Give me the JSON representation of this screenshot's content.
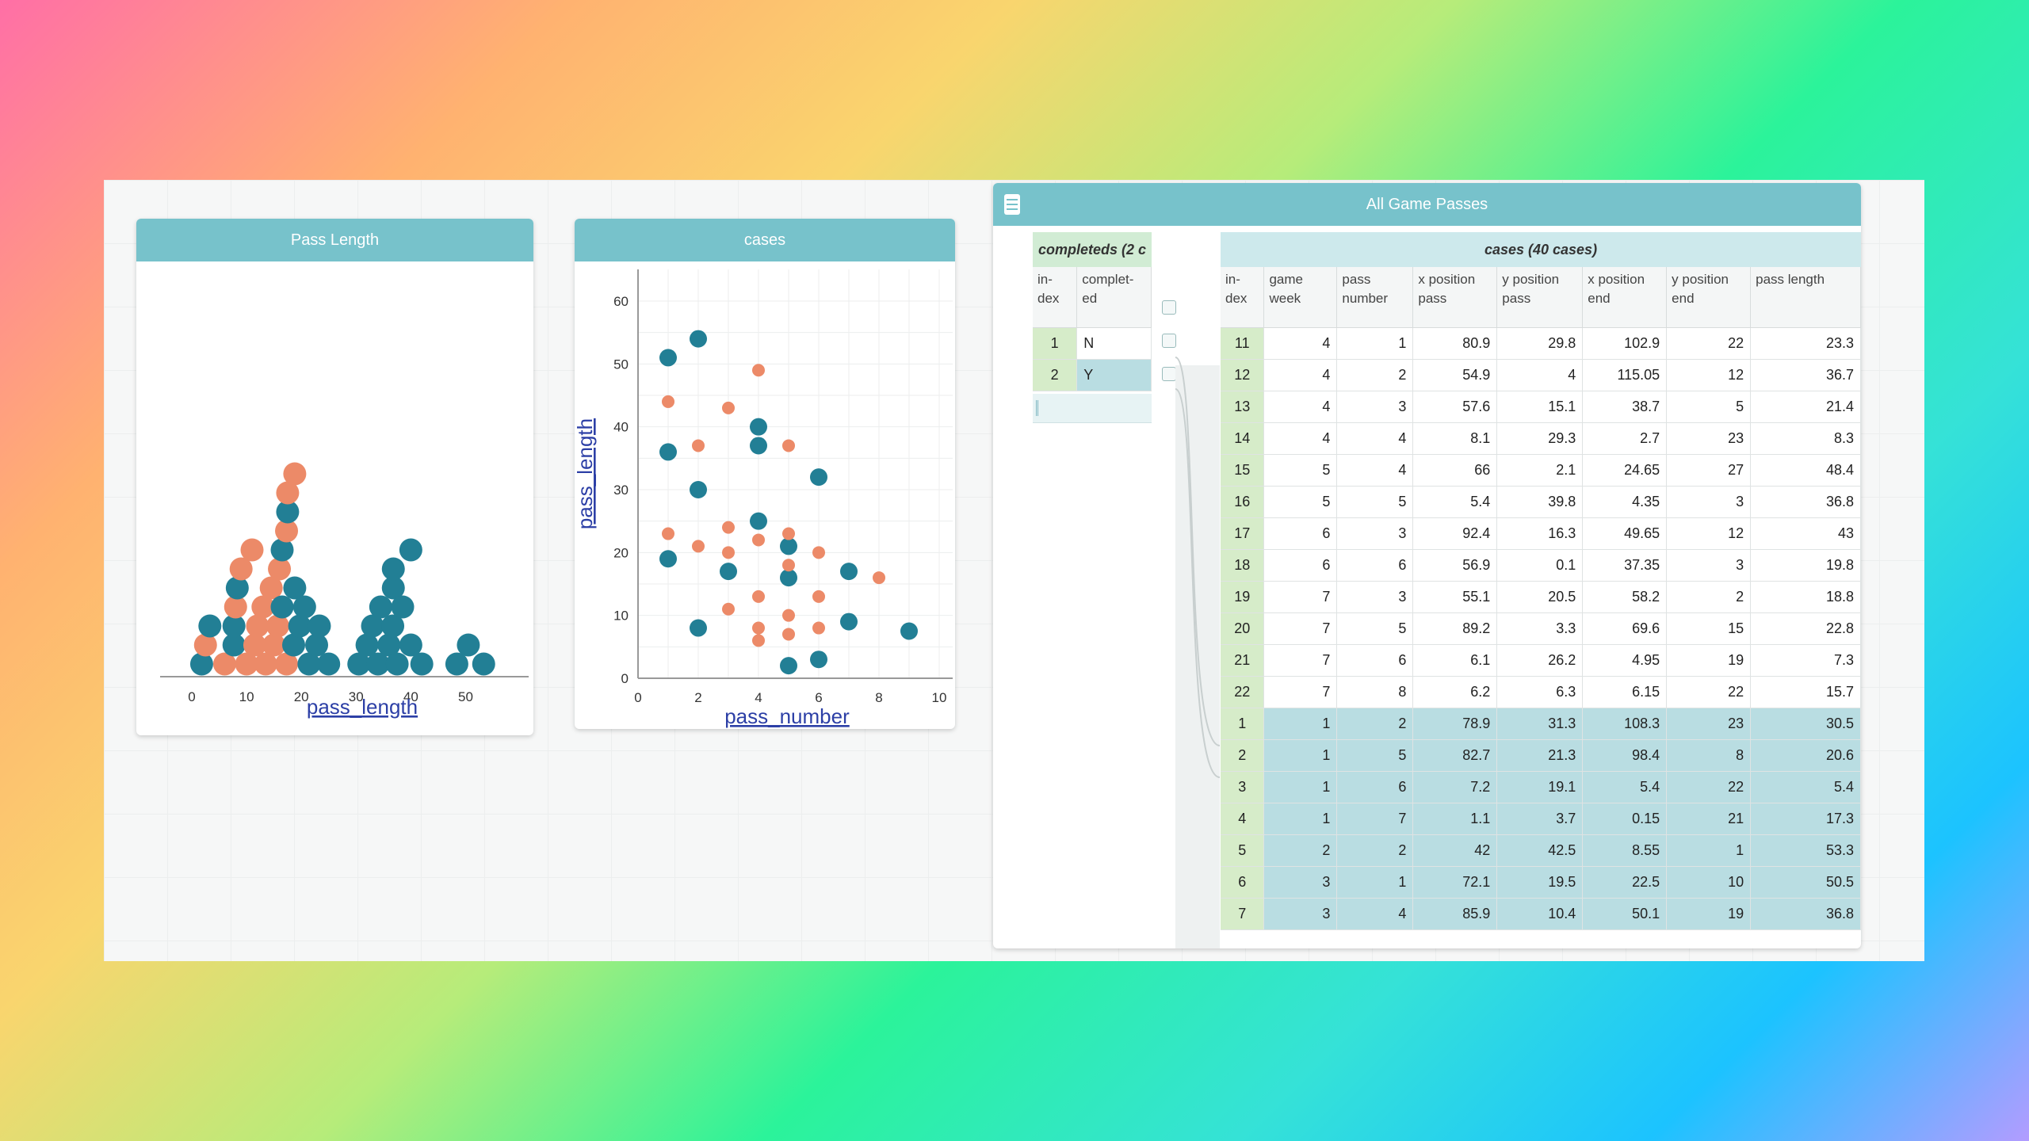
{
  "graph1": {
    "title": "Pass Length",
    "x_label": "pass_length",
    "x_ticks": [
      "0",
      "10",
      "20",
      "30",
      "40",
      "50"
    ]
  },
  "graph2": {
    "title": "cases",
    "x_label": "pass_number",
    "y_label": "pass_length",
    "x_ticks": [
      "0",
      "2",
      "4",
      "6",
      "8",
      "10"
    ],
    "y_ticks": [
      "0",
      "10",
      "20",
      "30",
      "40",
      "50",
      "60"
    ]
  },
  "colors": {
    "teal": "#227f95",
    "orange": "#ec8a68",
    "header": "#77c2cb"
  },
  "chart_data": [
    {
      "type": "dot plot",
      "title": "Pass Length",
      "xlabel": "pass_length",
      "xlim": [
        0,
        55
      ],
      "series": [
        {
          "values": [
            1.8,
            3.3,
            7.7,
            7.7,
            8.3,
            16.5,
            16.5,
            17.5,
            18.6,
            18.8,
            19.7,
            20.6,
            21.4,
            22.8,
            23.3,
            25.0,
            30.5,
            32.0,
            33.0,
            34.0,
            34.5,
            36.0,
            36.7,
            36.8,
            36.8,
            37.5,
            38.5,
            40.0,
            40.0,
            42.0,
            48.4,
            50.5,
            53.3
          ]
        },
        {
          "values": [
            2.5,
            6.0,
            8.0,
            9.0,
            10.0,
            11.0,
            11.5,
            12.0,
            13.0,
            13.5,
            14.5,
            15.0,
            15.7,
            16.0,
            17.3,
            17.3,
            17.5,
            18.8
          ]
        }
      ]
    },
    {
      "type": "scatter",
      "title": "cases",
      "xlabel": "pass_number",
      "ylabel": "pass_length",
      "xlim": [
        0,
        10
      ],
      "ylim": [
        0,
        60
      ],
      "series": [
        {
          "points": [
            [
              1,
              51
            ],
            [
              1,
              36
            ],
            [
              1,
              19
            ],
            [
              2,
              54
            ],
            [
              2,
              30
            ],
            [
              2,
              8
            ],
            [
              3,
              17
            ],
            [
              4,
              40
            ],
            [
              4,
              37
            ],
            [
              4,
              25
            ],
            [
              5,
              21
            ],
            [
              5,
              16
            ],
            [
              5,
              2
            ],
            [
              6,
              32
            ],
            [
              6,
              3
            ],
            [
              7,
              17
            ],
            [
              7,
              9
            ],
            [
              9,
              7.5
            ]
          ]
        },
        {
          "points": [
            [
              1,
              44
            ],
            [
              1,
              23
            ],
            [
              2,
              37
            ],
            [
              2,
              21
            ],
            [
              3,
              43
            ],
            [
              3,
              24
            ],
            [
              3,
              20
            ],
            [
              3,
              11
            ],
            [
              4,
              49
            ],
            [
              4,
              22
            ],
            [
              4,
              13
            ],
            [
              4,
              8
            ],
            [
              4,
              6
            ],
            [
              5,
              37
            ],
            [
              5,
              23
            ],
            [
              5,
              18
            ],
            [
              5,
              10
            ],
            [
              5,
              7
            ],
            [
              6,
              20
            ],
            [
              6,
              13
            ],
            [
              6,
              8
            ],
            [
              8,
              16
            ]
          ]
        }
      ]
    }
  ],
  "table": {
    "title": "All Game Passes",
    "parent_label": "completeds (2 c",
    "child_label": "cases (40 cases)",
    "parent_cols": [
      "in-dex",
      "complet-ed"
    ],
    "parent_rows": [
      [
        "1",
        "N"
      ],
      [
        "2",
        "Y"
      ]
    ],
    "child_cols": [
      "in-dex",
      "game week",
      "pass number",
      "x position pass",
      "y position pass",
      "x position end",
      "y position end",
      "pass length"
    ],
    "child_rows": [
      [
        "11",
        "4",
        "1",
        "80.9",
        "29.8",
        "102.9",
        "22",
        "23.3"
      ],
      [
        "12",
        "4",
        "2",
        "54.9",
        "4",
        "115.05",
        "12",
        "36.7"
      ],
      [
        "13",
        "4",
        "3",
        "57.6",
        "15.1",
        "38.7",
        "5",
        "21.4"
      ],
      [
        "14",
        "4",
        "4",
        "8.1",
        "29.3",
        "2.7",
        "23",
        "8.3"
      ],
      [
        "15",
        "5",
        "4",
        "66",
        "2.1",
        "24.65",
        "27",
        "48.4"
      ],
      [
        "16",
        "5",
        "5",
        "5.4",
        "39.8",
        "4.35",
        "3",
        "36.8"
      ],
      [
        "17",
        "6",
        "3",
        "92.4",
        "16.3",
        "49.65",
        "12",
        "43"
      ],
      [
        "18",
        "6",
        "6",
        "56.9",
        "0.1",
        "37.35",
        "3",
        "19.8"
      ],
      [
        "19",
        "7",
        "3",
        "55.1",
        "20.5",
        "58.2",
        "2",
        "18.8"
      ],
      [
        "20",
        "7",
        "5",
        "89.2",
        "3.3",
        "69.6",
        "15",
        "22.8"
      ],
      [
        "21",
        "7",
        "6",
        "6.1",
        "26.2",
        "4.95",
        "19",
        "7.3"
      ],
      [
        "22",
        "7",
        "8",
        "6.2",
        "6.3",
        "6.15",
        "22",
        "15.7"
      ],
      [
        "1",
        "1",
        "2",
        "78.9",
        "31.3",
        "108.3",
        "23",
        "30.5"
      ],
      [
        "2",
        "1",
        "5",
        "82.7",
        "21.3",
        "98.4",
        "8",
        "20.6"
      ],
      [
        "3",
        "1",
        "6",
        "7.2",
        "19.1",
        "5.4",
        "22",
        "5.4"
      ],
      [
        "4",
        "1",
        "7",
        "1.1",
        "3.7",
        "0.15",
        "21",
        "17.3"
      ],
      [
        "5",
        "2",
        "2",
        "42",
        "42.5",
        "8.55",
        "1",
        "53.3"
      ],
      [
        "6",
        "3",
        "1",
        "72.1",
        "19.5",
        "22.5",
        "10",
        "50.5"
      ],
      [
        "7",
        "3",
        "4",
        "85.9",
        "10.4",
        "50.1",
        "19",
        "36.8"
      ]
    ]
  }
}
